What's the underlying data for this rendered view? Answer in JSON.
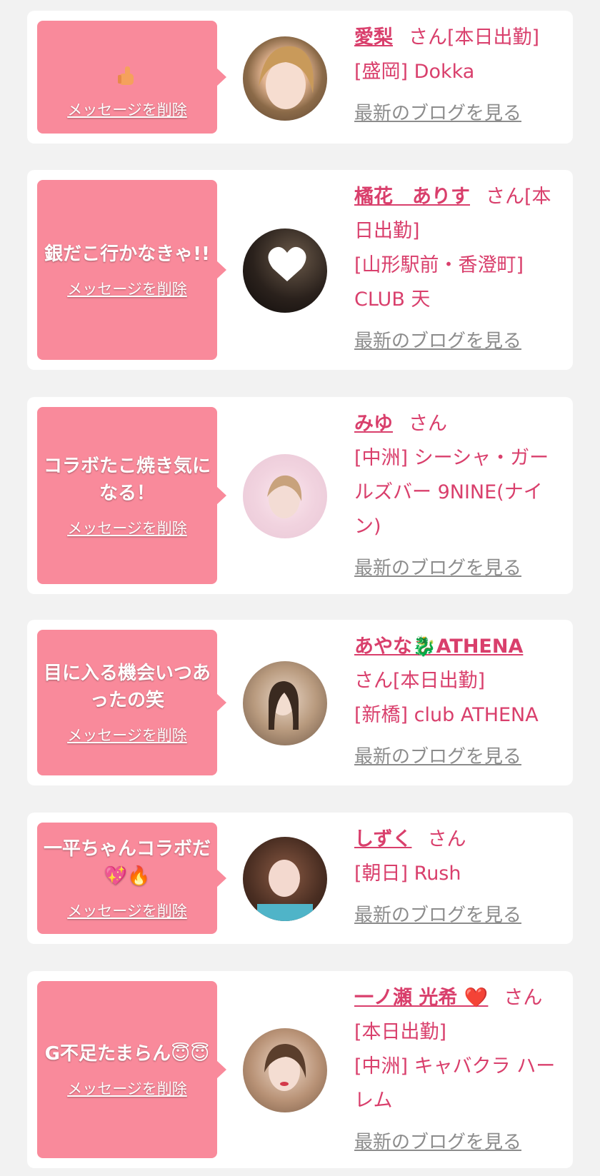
{
  "delete_label": "メッセージを削除",
  "blog_label": "最新のブログを見る",
  "san_suffix": "さん",
  "colors": {
    "bubble": "#f98a9b",
    "name": "#d93f6c",
    "blog_link": "#8c8c8c",
    "background": "#f2f2f2"
  },
  "items": [
    {
      "message": "👍",
      "name": "愛梨",
      "status": "さん[本日出勤]",
      "location": "[盛岡] Dokka",
      "avatar_icon": "avatar-photo"
    },
    {
      "message": "銀だこ行かなきゃ!!",
      "name": "橘花　ありす",
      "status": "さん[本日出勤]",
      "location": "[山形駅前・香澄町] CLUB 天",
      "avatar_icon": "avatar-photo-heart"
    },
    {
      "message": "コラボたこ焼き気になる！",
      "name": "みゆ",
      "status": "さん",
      "location": "[中洲] シーシャ・ガールズバー 9NINE(ナイン)",
      "avatar_icon": "avatar-photo"
    },
    {
      "message": "目に入る機会いつあったの笑",
      "name": "あやな🐉ATHENA",
      "status": "さん[本日出勤]",
      "location": "[新橋] club ATHENA",
      "avatar_icon": "avatar-photo"
    },
    {
      "message": "一平ちゃんコラボだ💖🔥",
      "name": "しずく",
      "status": "さん",
      "location": "[朝日] Rush",
      "avatar_icon": "avatar-photo"
    },
    {
      "message": "G不足たまらん😇😇",
      "name": "一ノ瀬 光希 ❤️",
      "status": "さん[本日出勤]",
      "location": "[中洲] キャバクラ ハーレム",
      "avatar_icon": "avatar-photo"
    }
  ]
}
